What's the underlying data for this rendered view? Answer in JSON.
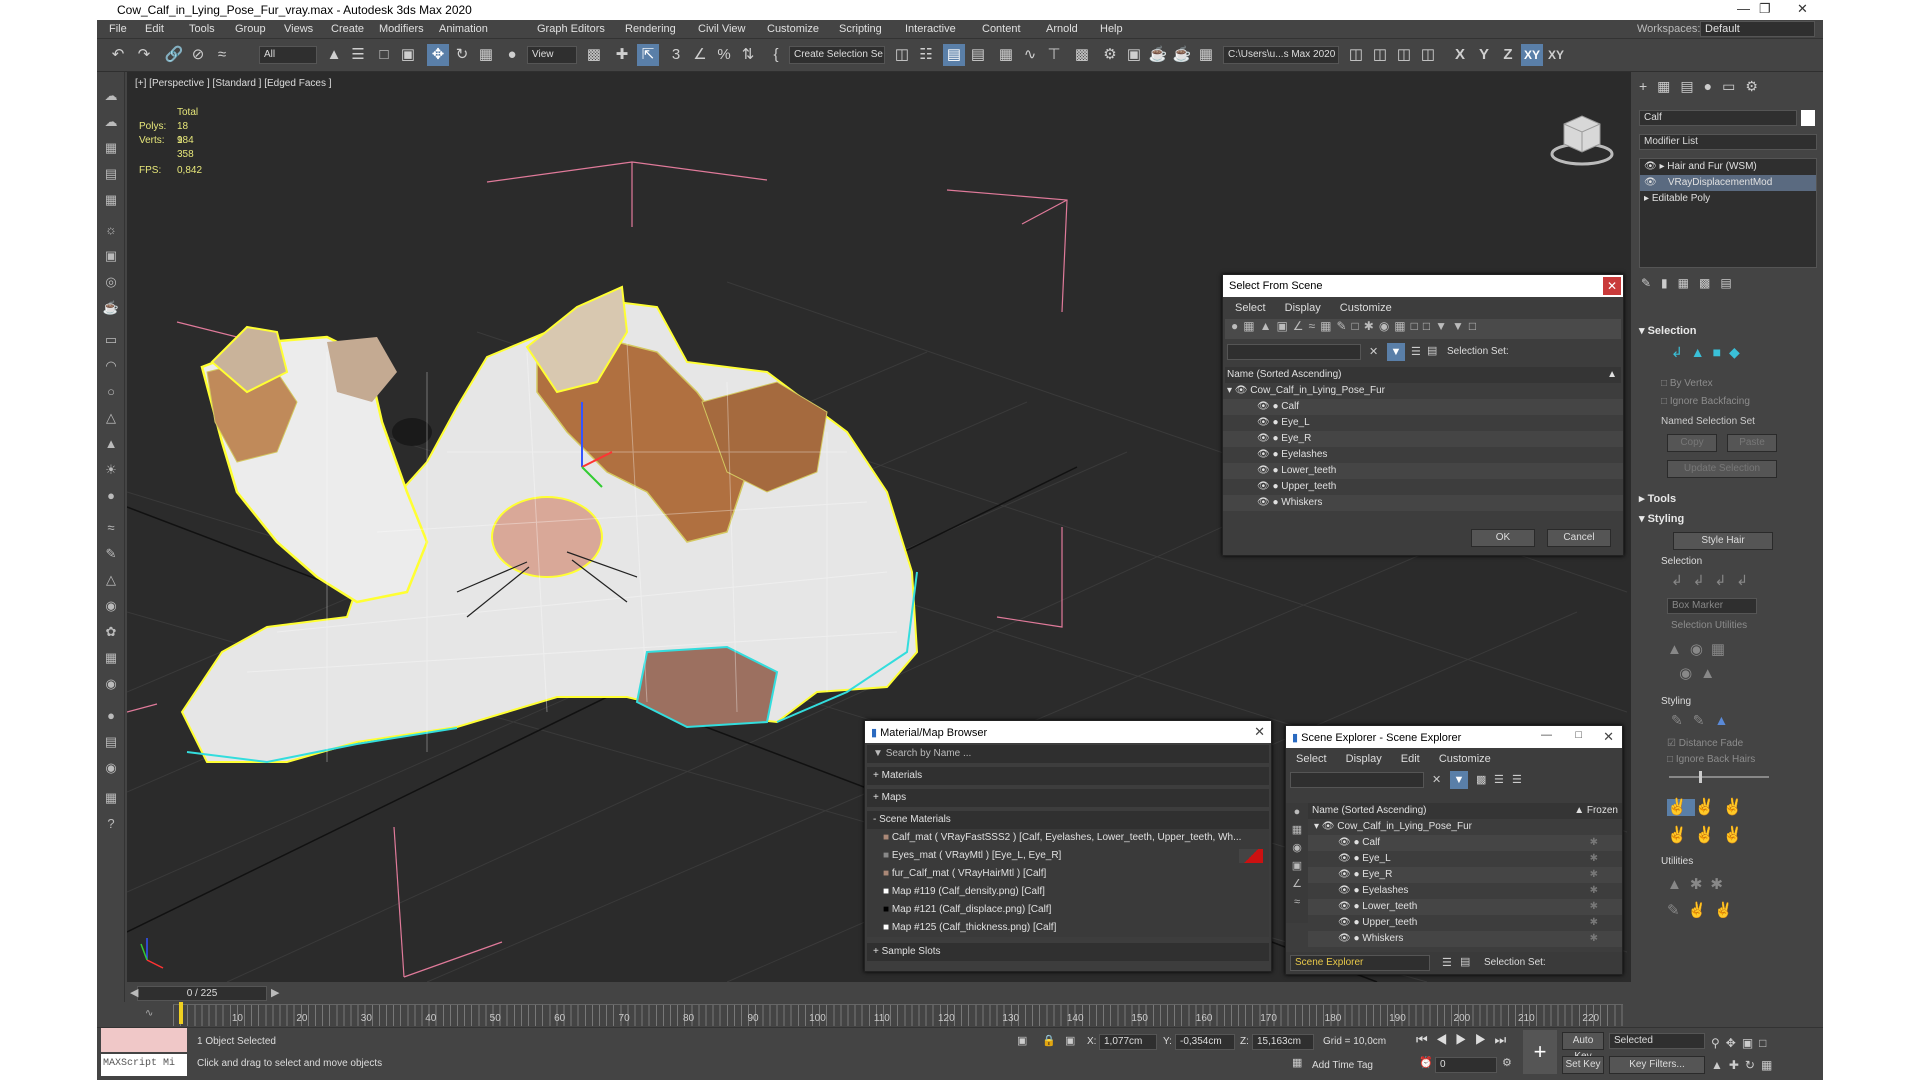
{
  "window": {
    "title": "Cow_Calf_in_Lying_Pose_Fur_vray.max - Autodesk 3ds Max 2020",
    "workspace_label": "Workspaces:",
    "workspace_value": "Default"
  },
  "menu": [
    "File",
    "Edit",
    "Tools",
    "Group",
    "Views",
    "Create",
    "Modifiers",
    "Animation",
    "Graph Editors",
    "Rendering",
    "Civil View",
    "Customize",
    "Scripting",
    "Interactive",
    "Content",
    "Arnold",
    "Help"
  ],
  "toolbar": {
    "filter": "All",
    "view": "View",
    "selection_set": "Create Selection Se",
    "path": "C:\\Users\\u...s Max 2020",
    "axes": [
      "X",
      "Y",
      "Z",
      "XY",
      "XY"
    ]
  },
  "viewport": {
    "label": "[+] [Perspective ] [Standard ] [Edged Faces ]",
    "stats": {
      "total": "Total",
      "polys_label": "Polys:",
      "polys": "18 184",
      "verts_label": "Verts:",
      "verts": "9 358",
      "fps_label": "FPS:",
      "fps": "0,842"
    }
  },
  "select_from_scene": {
    "title": "Select From Scene",
    "menu": [
      "Select",
      "Display",
      "Customize"
    ],
    "selection_set_label": "Selection Set:",
    "column": "Name (Sorted Ascending)",
    "root": "Cow_Calf_in_Lying_Pose_Fur",
    "items": [
      "Calf",
      "Eye_L",
      "Eye_R",
      "Eyelashes",
      "Lower_teeth",
      "Upper_teeth",
      "Whiskers"
    ],
    "ok": "OK",
    "cancel": "Cancel"
  },
  "material_browser": {
    "title": "Material/Map Browser",
    "search_placeholder": "Search by Name ...",
    "groups": [
      "+ Materials",
      "+ Maps",
      "- Scene Materials"
    ],
    "entries": [
      "Calf_mat  ( VRayFastSSS2 )  [Calf, Eyelashes, Lower_teeth, Upper_teeth, Wh...",
      "Eyes_mat  ( VRayMtl )  [Eye_L, Eye_R]",
      "fur_Calf_mat  ( VRayHairMtl )  [Calf]",
      "Map #119 (Calf_density.png)  [Calf]",
      "Map #121 (Calf_displace.png)  [Calf]",
      "Map #125 (Calf_thickness.png)  [Calf]"
    ],
    "sample_slots": "+ Sample Slots"
  },
  "scene_explorer": {
    "title": "Scene Explorer - Scene Explorer",
    "menu": [
      "Select",
      "Display",
      "Edit",
      "Customize"
    ],
    "column": "Name (Sorted Ascending)",
    "frozen": "▲ Frozen",
    "root": "Cow_Calf_in_Lying_Pose_Fur",
    "items": [
      "Calf",
      "Eye_L",
      "Eye_R",
      "Eyelashes",
      "Lower_teeth",
      "Upper_teeth",
      "Whiskers"
    ],
    "footer_name": "Scene Explorer",
    "selection_set_label": "Selection Set:"
  },
  "command_panel": {
    "object_name": "Calf",
    "modifier_list": "Modifier List",
    "stack": [
      "Hair and Fur (WSM)",
      "VRayDisplacementMod",
      "Editable Poly"
    ],
    "selection": "Selection",
    "by_vertex": "By Vertex",
    "ignore_backfacing": "Ignore Backfacing",
    "named_selection_set": "Named Selection Set",
    "copy": "Copy",
    "paste": "Paste",
    "update_selection": "Update Selection",
    "tools": "Tools",
    "styling": "Styling",
    "style_hair": "Style Hair",
    "sub_selection": "Selection",
    "box_marker": "Box Marker",
    "selection_utilities": "Selection Utilities",
    "sub_styling": "Styling",
    "distance_fade": "Distance Fade",
    "ignore_back_hairs": "Ignore Back Hairs",
    "utilities": "Utilities"
  },
  "timeline": {
    "frame": "0 / 225",
    "ticks": [
      "10",
      "20",
      "30",
      "40",
      "50",
      "60",
      "70",
      "80",
      "90",
      "100",
      "110",
      "120",
      "130",
      "140",
      "150",
      "160",
      "170",
      "180",
      "190",
      "200",
      "210",
      "220"
    ]
  },
  "status": {
    "maxscript": "MAXScript Mi",
    "selected": "1 Object Selected",
    "prompt": "Click and drag to select and move objects",
    "x_label": "X:",
    "x": "1,077cm",
    "y_label": "Y:",
    "y": "-0,354cm",
    "z_label": "Z:",
    "z": "15,163cm",
    "grid": "Grid = 10,0cm",
    "add_time_tag": "Add Time Tag",
    "auto_key": "Auto Key",
    "set_key": "Set Key",
    "key_mode": "Selected",
    "key_filters": "Key Filters...",
    "frame_value": "0"
  }
}
